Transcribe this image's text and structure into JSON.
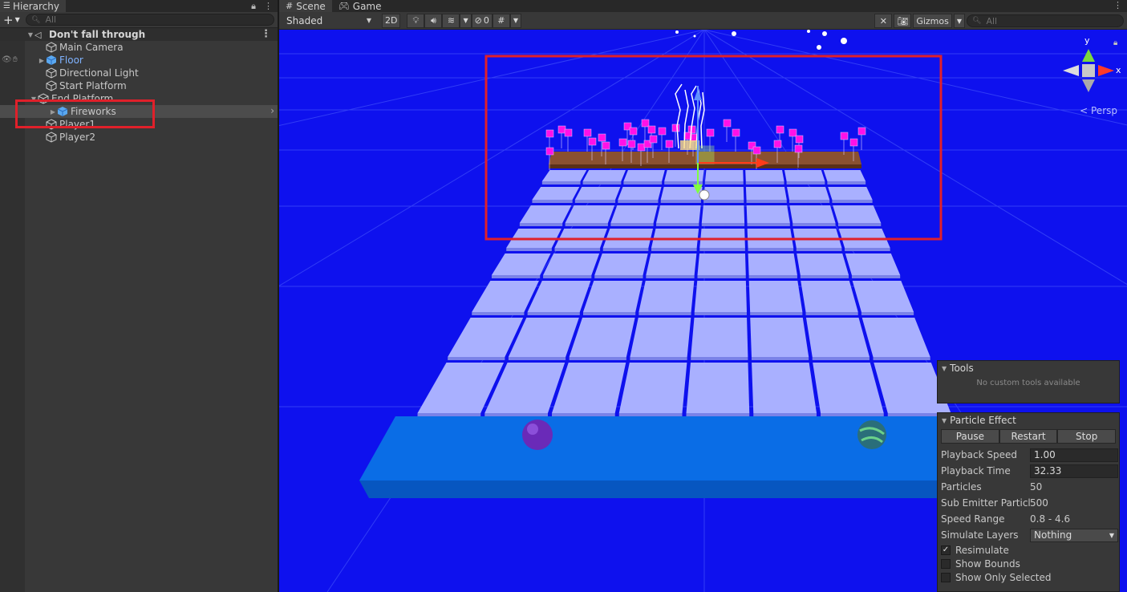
{
  "hierarchy": {
    "tab_label": "Hierarchy",
    "search_placeholder": "All",
    "scene_name": "Don't fall through",
    "items": [
      {
        "label": "Main Camera"
      },
      {
        "label": "Floor"
      },
      {
        "label": "Directional Light"
      },
      {
        "label": "Start Platform"
      },
      {
        "label": "End Platform"
      },
      {
        "label": "Fireworks"
      },
      {
        "label": "Player1"
      },
      {
        "label": "Player2"
      }
    ]
  },
  "scene": {
    "tabs": [
      {
        "label": "Scene"
      },
      {
        "label": "Game"
      }
    ],
    "shading_mode": "Shaded",
    "mode_2d": "2D",
    "hidden_count": "0",
    "gizmos_label": "Gizmos",
    "search_placeholder": "All",
    "persp_label": "Persp",
    "axis_y": "y",
    "axis_x": "x"
  },
  "tools_overlay": {
    "title": "Tools",
    "note": "No custom tools available"
  },
  "particle_effect": {
    "title": "Particle Effect",
    "buttons": {
      "pause": "Pause",
      "restart": "Restart",
      "stop": "Stop"
    },
    "playback_speed": {
      "label": "Playback Speed",
      "value": "1.00"
    },
    "playback_time": {
      "label": "Playback Time",
      "value": "32.33"
    },
    "particles": {
      "label": "Particles",
      "value": "50"
    },
    "sub_emitter": {
      "label": "Sub Emitter Particles",
      "value": "500"
    },
    "speed_range": {
      "label": "Speed Range",
      "value": "0.8 - 4.6"
    },
    "simulate_layers": {
      "label": "Simulate Layers",
      "value": "Nothing"
    },
    "resimulate": {
      "label": "Resimulate",
      "checked": true
    },
    "show_bounds": {
      "label": "Show Bounds",
      "checked": false
    },
    "show_only_selected": {
      "label": "Show Only Selected",
      "checked": false
    }
  },
  "colors": {
    "scene_background": "#0e11ee",
    "tile": "#a9b0ff",
    "platform": "#0a6de6",
    "end_platform": "#8a5030",
    "firework_particles": "#ff10e8",
    "highlight_box": "#e0202a"
  }
}
